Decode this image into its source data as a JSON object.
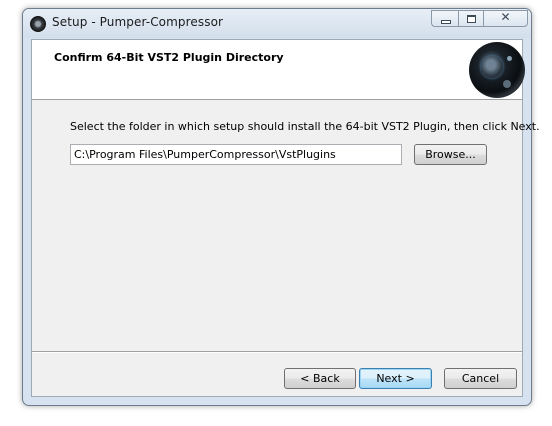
{
  "window": {
    "title": "Setup - Pumper-Compressor",
    "close_glyph": "✕"
  },
  "header": {
    "title": "Confirm 64-Bit VST2 Plugin Directory",
    "logo_icon": "pumper-compressor-knob-icon"
  },
  "body": {
    "instruction": "Select the folder in which setup should install the 64-bit VST2 Plugin, then click Next.",
    "path_value": "C:\\Program Files\\PumperCompressor\\VstPlugins",
    "browse_label": "Browse..."
  },
  "footer": {
    "back_label": "< Back",
    "next_label": "Next >",
    "cancel_label": "Cancel"
  },
  "colors": {
    "frame": "#d6e2ef",
    "client": "#f0f0f0",
    "default_button_border": "#3c7fb1"
  }
}
